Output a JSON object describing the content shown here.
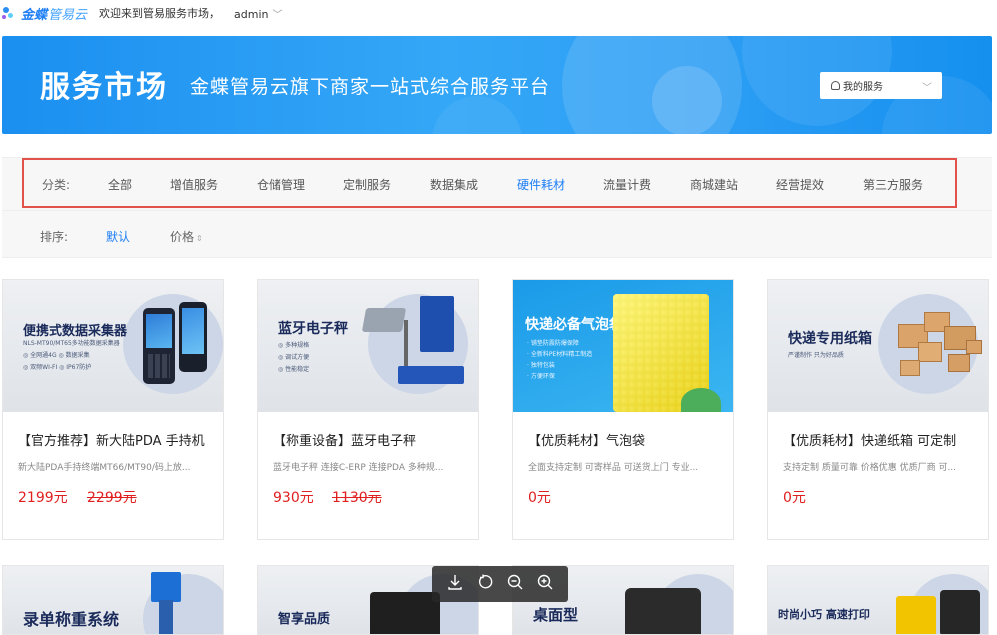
{
  "topbar": {
    "logo_main": "金蝶",
    "logo_sub": "管易云",
    "welcome": "欢迎来到管易服务市场，",
    "user": "admin"
  },
  "banner": {
    "title": "服务市场",
    "subtitle": "金蝶管易云旗下商家一站式综合服务平台",
    "my_service": "我的服务"
  },
  "filter": {
    "category_label": "分类:",
    "categories": [
      "全部",
      "增值服务",
      "仓储管理",
      "定制服务",
      "数据集成",
      "硬件耗材",
      "流量计费",
      "商城建站",
      "经营提效",
      "第三方服务"
    ],
    "active_category": "硬件耗材",
    "sort_label": "排序:",
    "sort_default": "默认",
    "sort_price": "价格"
  },
  "products": [
    {
      "img_heading": "便携式数据采集器",
      "img_sub": "NLS-MT90/MT65多功能数据采集器",
      "img_bullets": [
        "◎ 全网通4G  ◎ 数据采集",
        "◎ 双频WI-FI  ◎ IP67防护"
      ],
      "title": "【官方推荐】新大陆PDA 手持机",
      "desc": "新大陆PDA手持终端MT66/MT90/码上放...",
      "price": "2199元",
      "old_price": "2299元"
    },
    {
      "img_heading": "蓝牙电子秤",
      "img_bullets": [
        "◎ 多种规格",
        "◎ 调试方便",
        "◎ 性能稳定"
      ],
      "title": "【称重设备】蓝牙电子秤",
      "desc": "蓝牙电子秤 连接C-ERP 连接PDA 多种规...",
      "price": "930元",
      "old_price": "1130元"
    },
    {
      "img_heading": "快递必备气泡袋",
      "img_bullets": [
        "· 铺垫防震防爆保障",
        "· 全新料PE材料精工制造",
        "· 独特包装",
        "· 方便环保"
      ],
      "title": "【优质耗材】气泡袋",
      "desc": "全面支持定制 可寄样品 可送货上门 专业...",
      "price": "0元",
      "old_price": ""
    },
    {
      "img_heading": "快递专用纸箱",
      "img_sub": "严谨制作 只为好品质",
      "title": "【优质耗材】快递纸箱 可定制",
      "desc": "支持定制 质量可靠 价格优惠 优质厂商 可...",
      "price": "0元",
      "old_price": ""
    }
  ],
  "products_row2": [
    {
      "img_heading": "录单称重系统"
    },
    {
      "img_heading": "智享品质"
    },
    {
      "img_heading": "桌面型"
    },
    {
      "img_heading": "时尚小巧 高速打印"
    }
  ],
  "viewer_toolbar": {
    "icons": [
      "download-icon",
      "rotate-icon",
      "zoom-out-icon",
      "zoom-in-icon"
    ]
  }
}
